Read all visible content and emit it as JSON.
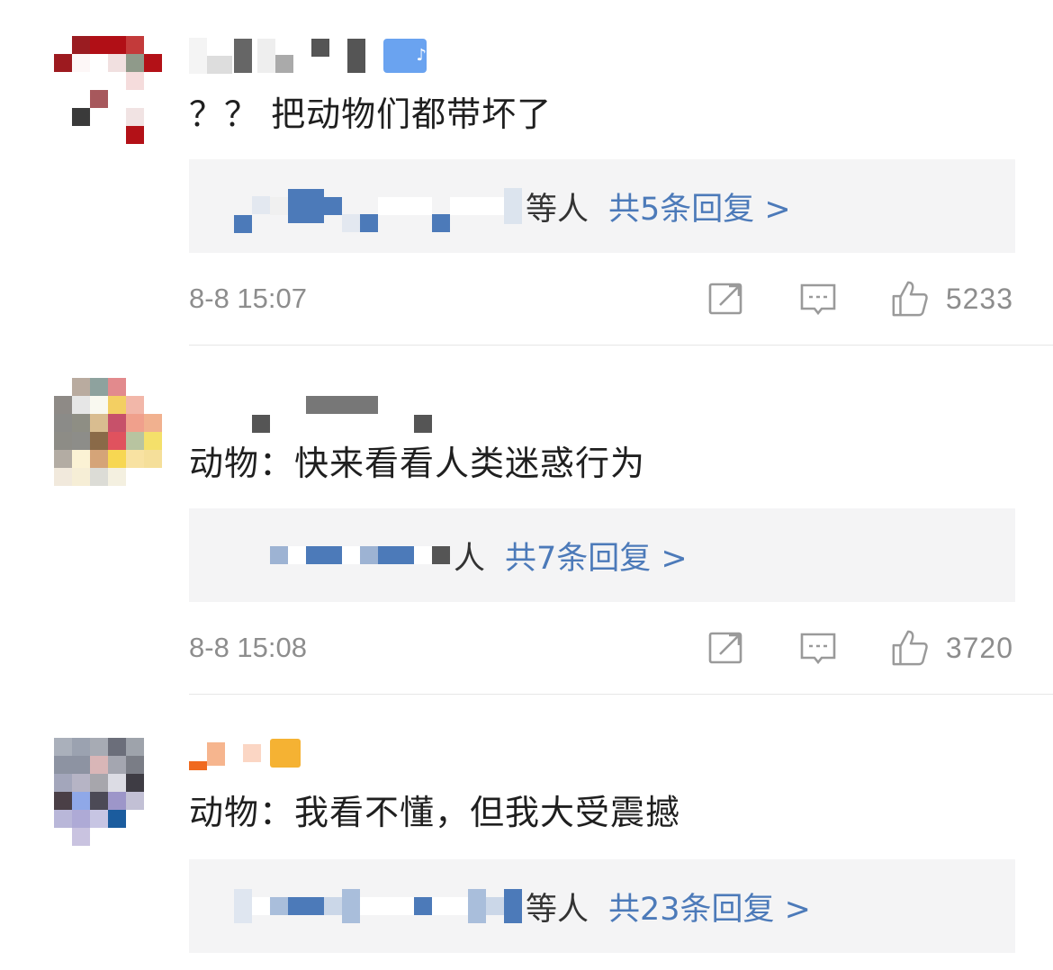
{
  "comments": [
    {
      "text": "？？ 把动物们都带坏了",
      "reply_etc": "等人",
      "reply_count_label": "共5条回复 >",
      "timestamp": "8-8 15:07",
      "likes": "5233"
    },
    {
      "text": "动物：快来看看人类迷惑行为",
      "reply_etc": "人",
      "reply_count_label": "共7条回复 >",
      "timestamp": "8-8 15:08",
      "likes": "3720"
    },
    {
      "text": "动物：我看不懂，但我大受震撼",
      "reply_etc": "等人",
      "reply_count_label": "共23条回复 >",
      "timestamp": "",
      "likes": ""
    }
  ],
  "icons": {
    "repost": "repost-icon",
    "comment": "comment-icon",
    "like": "like-icon",
    "badge": "vip-badge-icon"
  },
  "colors": {
    "reply_link": "#4c7ab9",
    "meta_gray": "#8d8d8d",
    "reply_bg": "#f4f4f5"
  }
}
